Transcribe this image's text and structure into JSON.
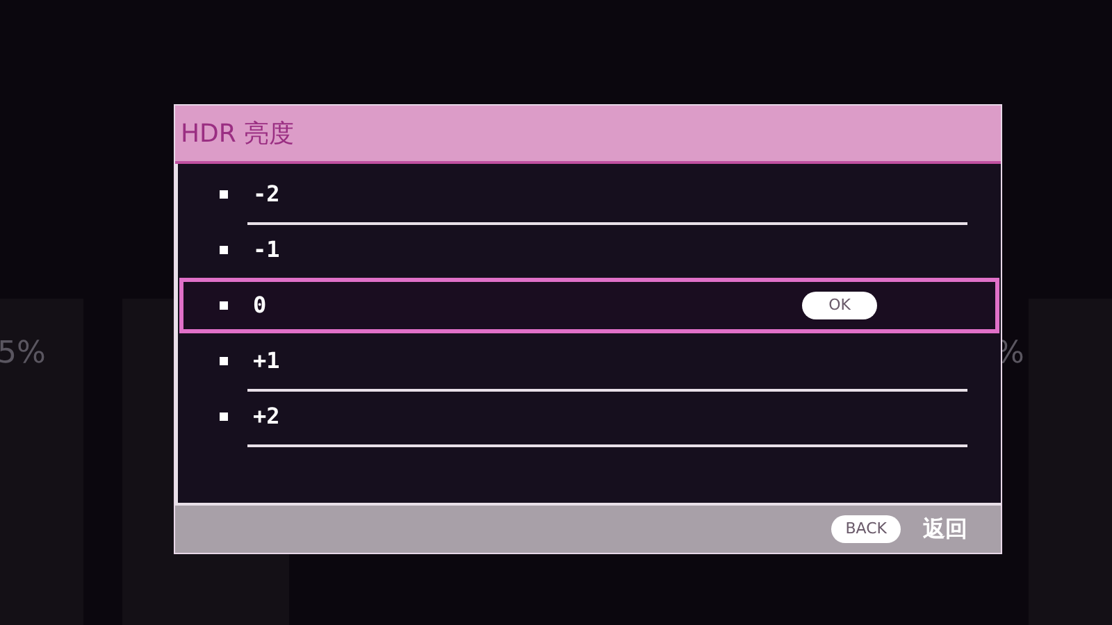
{
  "background_labels": [
    "5%",
    "%"
  ],
  "dialog": {
    "title": "HDR 亮度",
    "options": [
      {
        "label": "-2",
        "selected": false,
        "divider": true
      },
      {
        "label": "-1",
        "selected": false,
        "divider": false
      },
      {
        "label": "0",
        "selected": true,
        "divider": false,
        "confirm": "OK"
      },
      {
        "label": "+1",
        "selected": false,
        "divider": true
      },
      {
        "label": "+2",
        "selected": false,
        "divider": true
      }
    ],
    "footer": {
      "key": "BACK",
      "action": "返回"
    }
  }
}
